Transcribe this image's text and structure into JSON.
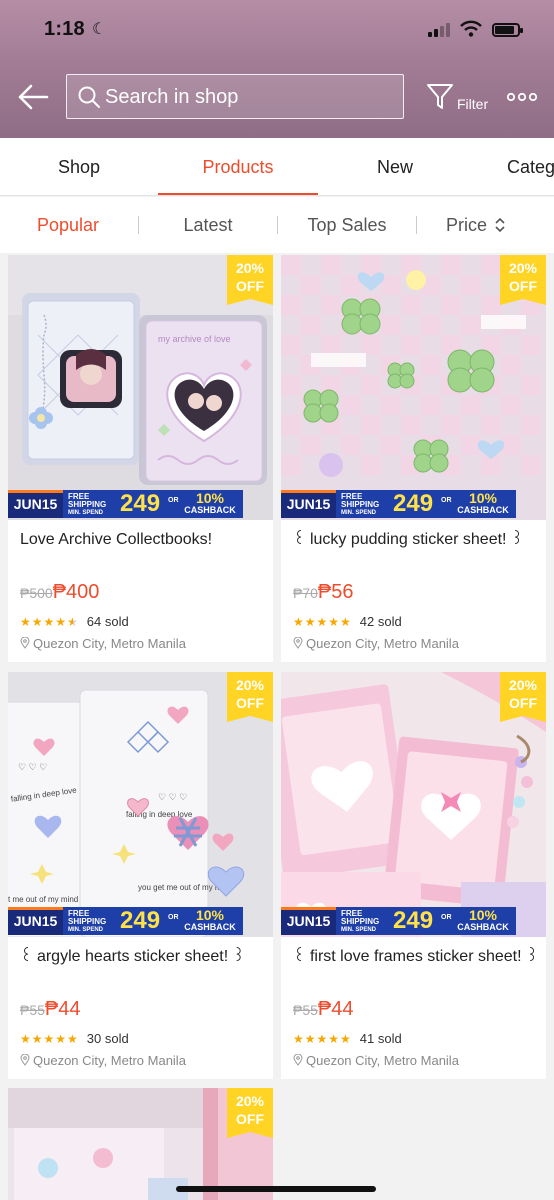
{
  "status_bar": {
    "time": "1:18"
  },
  "header": {
    "search_placeholder": "Search in shop",
    "filter_label": "Filter"
  },
  "tabs": [
    "Shop",
    "Products",
    "New",
    "Categ"
  ],
  "sort": {
    "popular": "Popular",
    "latest": "Latest",
    "top_sales": "Top Sales",
    "price": "Price"
  },
  "promo": {
    "date": "JUN15",
    "free": "FREE",
    "shipping": "SHIPPING",
    "min_spend": "MIN. SPEND",
    "amount": "249",
    "or": "OR",
    "cashback_pct": "10%",
    "cashback": "CASHBACK"
  },
  "products": [
    {
      "name": "Love Archive Collectbooks!",
      "old_price": "₱500",
      "price": "₱400",
      "sold": "64 sold",
      "rating": 4.5,
      "location": "Quezon City, Metro Manila",
      "discount": "20%",
      "off": "OFF"
    },
    {
      "name": "꒰ lucky pudding sticker sheet! ꒱",
      "old_price": "₱70",
      "price": "₱56",
      "sold": "42 sold",
      "rating": 5,
      "location": "Quezon City, Metro Manila",
      "discount": "20%",
      "off": "OFF"
    },
    {
      "name": "꒰ argyle hearts sticker sheet! ꒱",
      "old_price": "₱55",
      "price": "₱44",
      "sold": "30 sold",
      "rating": 5,
      "location": "Quezon City, Metro Manila",
      "discount": "20%",
      "off": "OFF"
    },
    {
      "name": "꒰ first love frames sticker sheet! ꒱",
      "old_price": "₱55",
      "price": "₱44",
      "sold": "41 sold",
      "rating": 5,
      "location": "Quezon City, Metro Manila",
      "discount": "20%",
      "off": "OFF"
    },
    {
      "name": "",
      "discount": "20%",
      "off": "OFF"
    }
  ],
  "colors": {
    "accent": "#ee4d2d",
    "header": "#a27c95",
    "badge": "#ffd424",
    "star": "#f6a700"
  }
}
